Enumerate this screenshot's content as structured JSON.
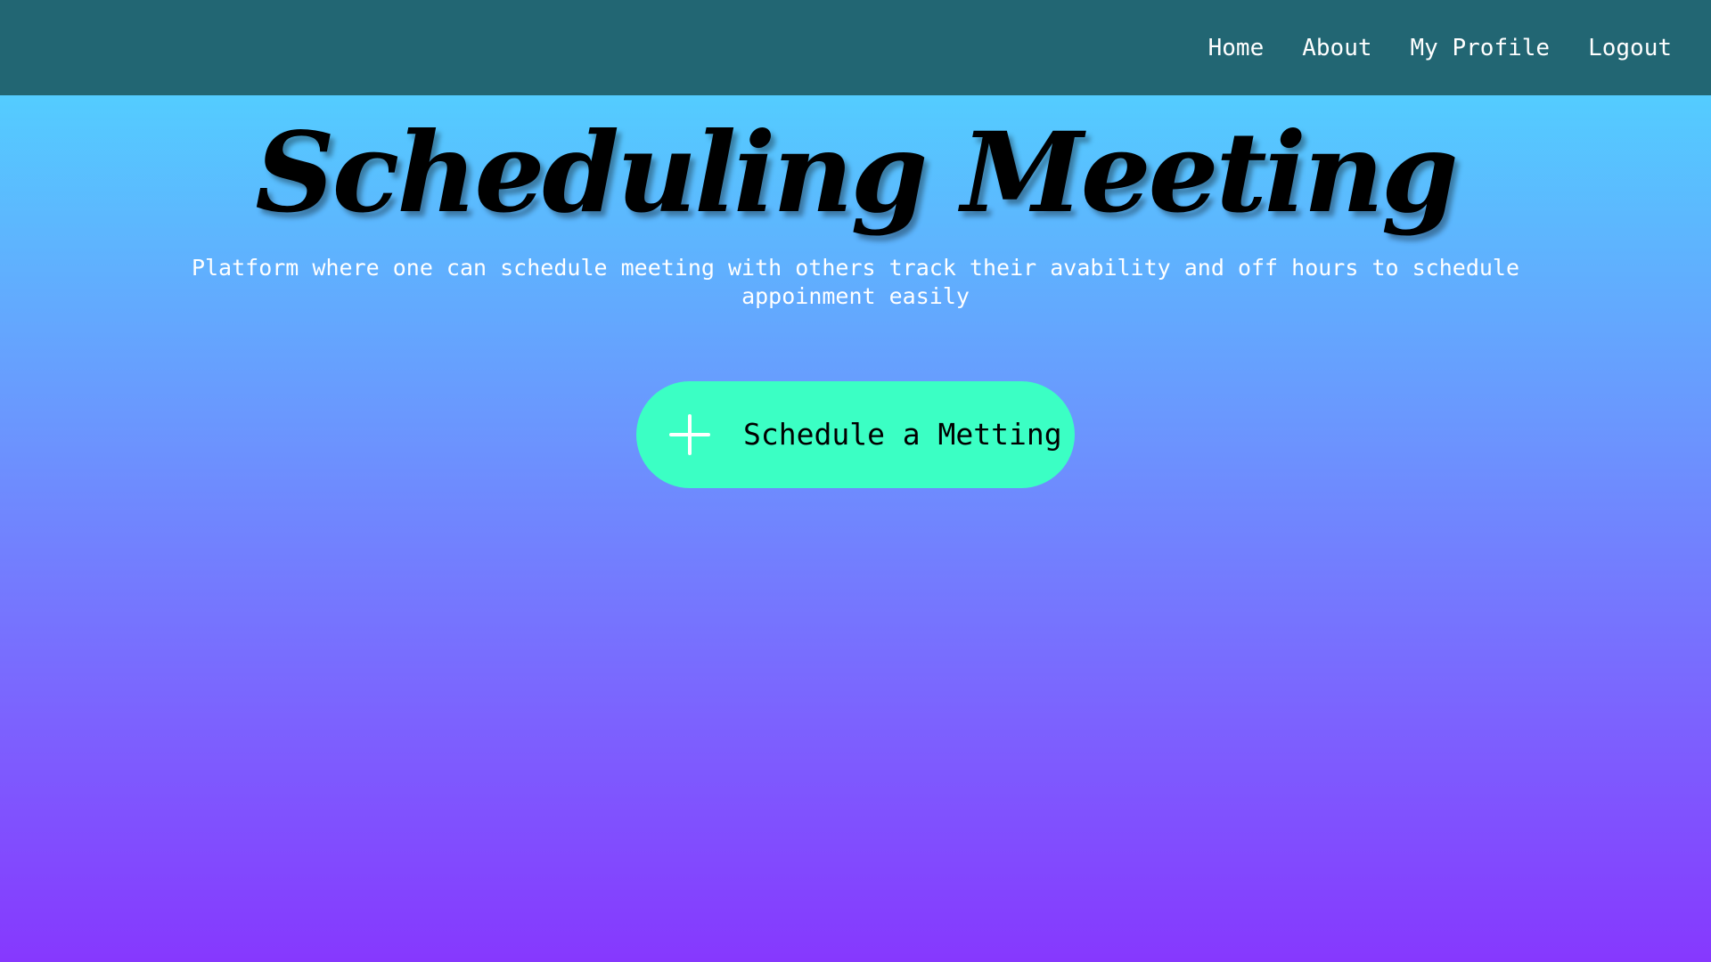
{
  "nav": {
    "items": [
      {
        "label": "Home"
      },
      {
        "label": "About"
      },
      {
        "label": "My Profile"
      },
      {
        "label": "Logout"
      }
    ]
  },
  "hero": {
    "title": "Scheduling Meeting",
    "subtitle": "Platform where one can schedule meeting with others track their avability and off hours to schedule appoinment easily"
  },
  "cta": {
    "label": "Schedule a Metting",
    "icon": "plus-icon"
  },
  "colors": {
    "navbar": "#226673",
    "gradient_top": "#4ddcff",
    "gradient_bottom": "#8638fe",
    "button": "#3bffc4"
  }
}
